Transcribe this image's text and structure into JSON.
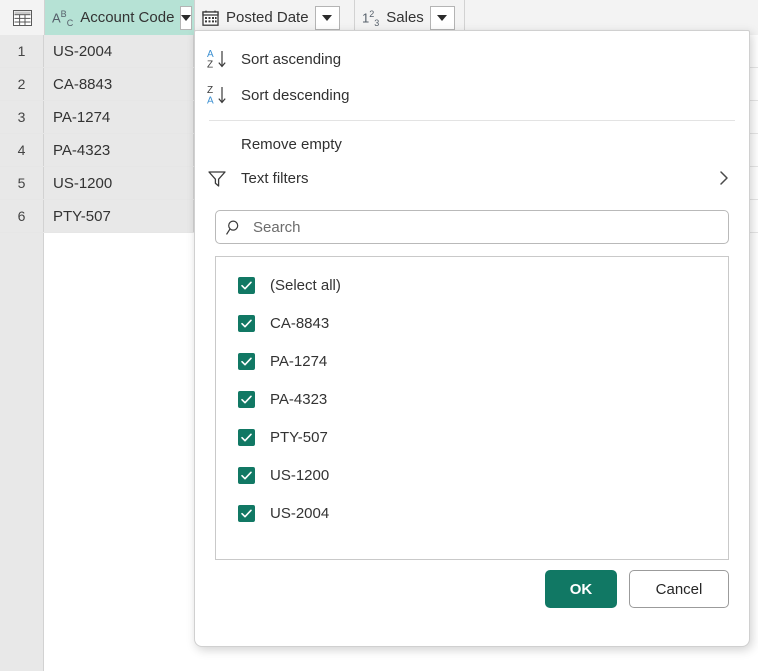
{
  "colors": {
    "accent_teal": "#117864",
    "header_selected": "#b6e2d5",
    "sort_letter_blue": "#3b8fd1",
    "panel_border": "#d0d0d0"
  },
  "grid": {
    "corner_icon": "table-icon",
    "columns": [
      {
        "type_icon": "abc-icon",
        "type_glyph_main": "A",
        "type_glyph_sup": "B",
        "type_glyph_sub": "C",
        "title": "Account Code",
        "selected": true
      },
      {
        "type_icon": "calendar-icon",
        "title": "Posted Date",
        "selected": false
      },
      {
        "type_icon": "number-123-icon",
        "type_glyph_main": "1",
        "type_glyph_sup": "2",
        "type_glyph_sub": "3",
        "title": "Sales",
        "selected": false
      }
    ],
    "rows": [
      {
        "number": "1",
        "account_code": "US-2004"
      },
      {
        "number": "2",
        "account_code": "CA-8843"
      },
      {
        "number": "3",
        "account_code": "PA-1274"
      },
      {
        "number": "4",
        "account_code": "PA-4323"
      },
      {
        "number": "5",
        "account_code": "US-1200"
      },
      {
        "number": "6",
        "account_code": "PTY-507"
      }
    ]
  },
  "filter_panel": {
    "menu": {
      "sort_ascending": "Sort ascending",
      "sort_descending": "Sort descending",
      "remove_empty": "Remove empty",
      "text_filters": "Text filters",
      "sort_asc_icon": "sort-a-to-z-icon",
      "sort_desc_icon": "sort-z-to-a-icon",
      "text_filters_icon": "funnel-icon",
      "text_filters_chevron": "chevron-right-icon"
    },
    "search": {
      "icon": "search-icon",
      "placeholder": "Search",
      "value": ""
    },
    "values": [
      {
        "label": "(Select all)",
        "checked": true
      },
      {
        "label": "CA-8843",
        "checked": true
      },
      {
        "label": "PA-1274",
        "checked": true
      },
      {
        "label": "PA-4323",
        "checked": true
      },
      {
        "label": "PTY-507",
        "checked": true
      },
      {
        "label": "US-1200",
        "checked": true
      },
      {
        "label": "US-2004",
        "checked": true
      }
    ],
    "buttons": {
      "ok": "OK",
      "cancel": "Cancel"
    }
  }
}
